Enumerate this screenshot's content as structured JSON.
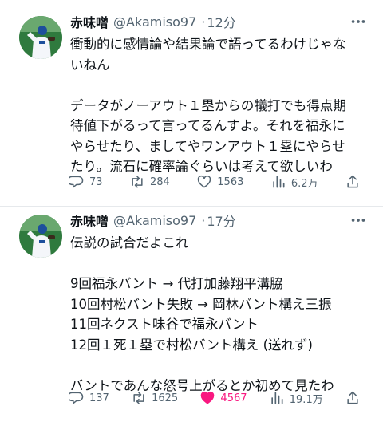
{
  "tweets": [
    {
      "author": {
        "name": "赤味噌",
        "handle": "@Akamiso97",
        "time": "12分"
      },
      "lines": [
        "衝動的に感情論や結果論で語ってるわけじゃな",
        "いねん",
        "",
        "",
        "データがノーアウト１塁からの犠打でも得点期",
        "待値下がるって言ってるんすよ。それを福永に",
        "やらせたり、ましてやワンアウト１塁にやらせ",
        "たり。流石に確率論ぐらいは考えて欲しいわ"
      ],
      "stats": {
        "replies": "73",
        "retweets": "284",
        "likes": "1563",
        "views": "6.2万"
      },
      "liked": false
    },
    {
      "author": {
        "name": "赤味噌",
        "handle": "@Akamiso97",
        "time": "17分"
      },
      "lines": [
        "伝説の試合だよこれ",
        "",
        "9回福永バント → 代打加藤翔平溝脇",
        "10回村松バント失敗 → 岡林バント構え三振",
        "11回ネクスト味谷で福永バント",
        "12回１死１塁で村松バント構え (送れず)",
        "",
        "バントであんな怒号上がるとか初めて見たわ"
      ],
      "stats": {
        "replies": "137",
        "retweets": "1625",
        "likes": "4567",
        "views": "19.1万"
      },
      "liked": true
    }
  ],
  "icons": {
    "reply": "speech-bubble-icon",
    "retweet": "retweet-icon",
    "like": "heart-icon",
    "views": "bar-chart-icon",
    "share": "share-icon",
    "more": "more-dots-icon"
  },
  "colors": {
    "like_active": "#f91880",
    "secondary_text": "#536471",
    "primary_text": "#0f1419"
  }
}
